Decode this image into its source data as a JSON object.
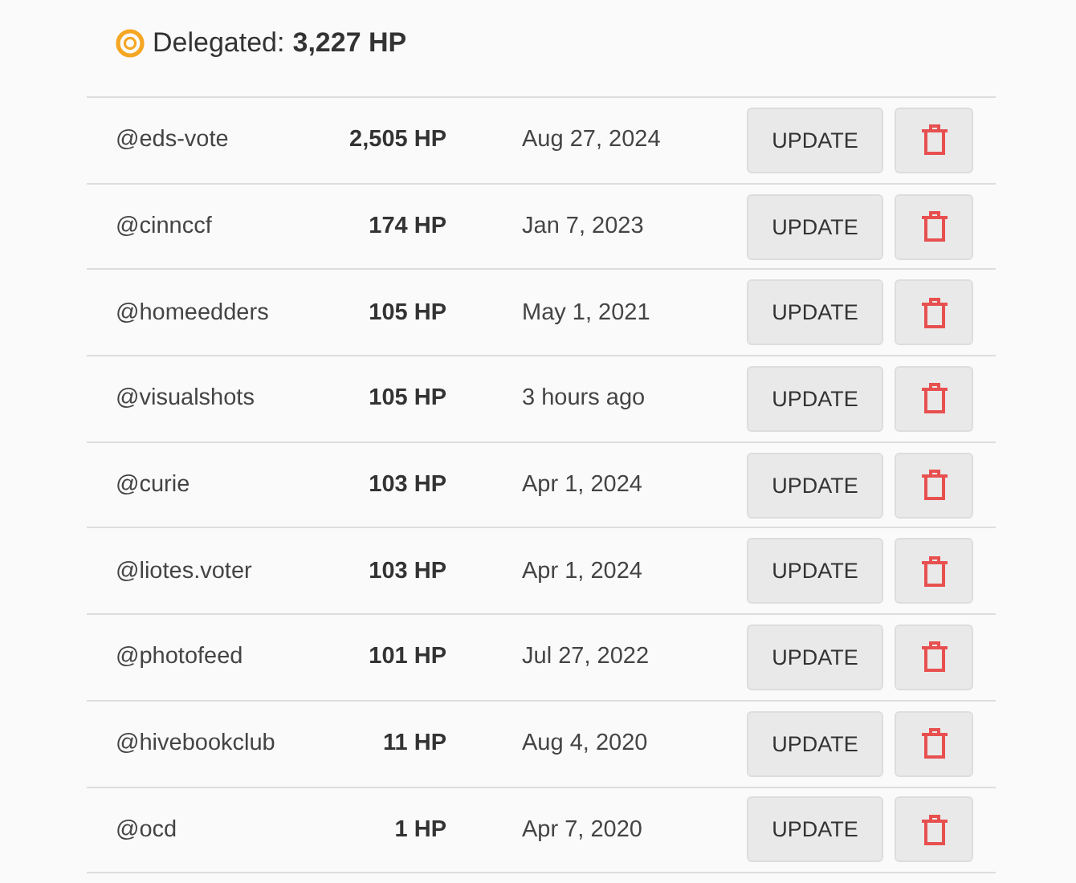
{
  "summary": {
    "label": "Delegated:",
    "amount": "3,227 HP"
  },
  "delegations": [
    {
      "account": "@eds-vote",
      "amount": "2,505 HP",
      "date": "Aug 27, 2024",
      "update_label": "UPDATE"
    },
    {
      "account": "@cinnccf",
      "amount": "174 HP",
      "date": "Jan 7, 2023",
      "update_label": "UPDATE"
    },
    {
      "account": "@homeedders",
      "amount": "105 HP",
      "date": "May 1, 2021",
      "update_label": "UPDATE"
    },
    {
      "account": "@visualshots",
      "amount": "105 HP",
      "date": "3 hours ago",
      "update_label": "UPDATE"
    },
    {
      "account": "@curie",
      "amount": "103 HP",
      "date": "Apr 1, 2024",
      "update_label": "UPDATE"
    },
    {
      "account": "@liotes.voter",
      "amount": "103 HP",
      "date": "Apr 1, 2024",
      "update_label": "UPDATE"
    },
    {
      "account": "@photofeed",
      "amount": "101 HP",
      "date": "Jul 27, 2022",
      "update_label": "UPDATE"
    },
    {
      "account": "@hivebookclub",
      "amount": "11 HP",
      "date": "Aug 4, 2020",
      "update_label": "UPDATE"
    },
    {
      "account": "@ocd",
      "amount": "1 HP",
      "date": "Apr 7, 2020",
      "update_label": "UPDATE"
    }
  ]
}
